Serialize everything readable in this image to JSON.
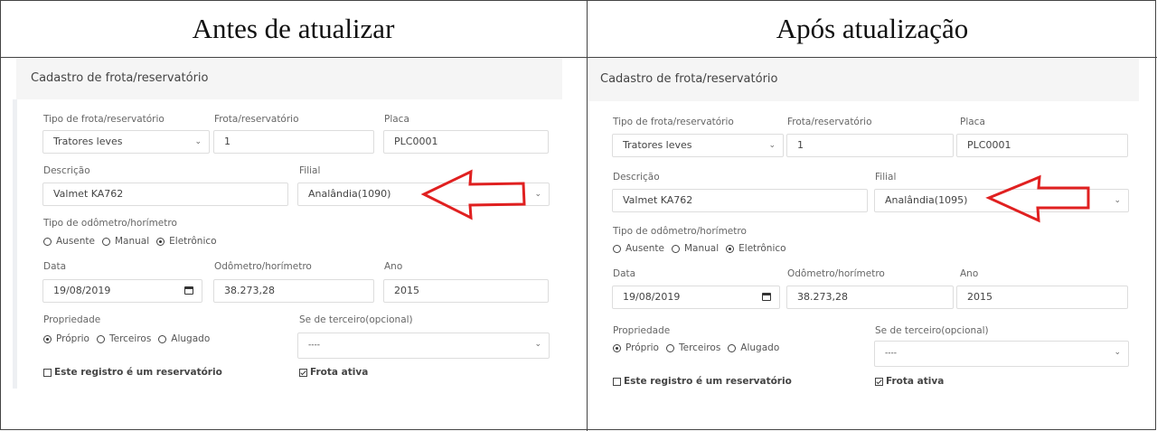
{
  "headers": {
    "left": "Antes de atualizar",
    "right": "Após atualização"
  },
  "form": {
    "title": "Cadastro de frota/reservatório",
    "tipo_label": "Tipo de frota/reservatório",
    "tipo_value": "Tratores leves",
    "frota_label": "Frota/reservatório",
    "frota_value": "1",
    "placa_label": "Placa",
    "placa_value": "PLC0001",
    "descricao_label": "Descrição",
    "descricao_value": "Valmet KA762",
    "filial_label": "Filial",
    "odometro_tipo_label": "Tipo de odômetro/horímetro",
    "odometro_options": [
      "Ausente",
      "Manual",
      "Eletrônico"
    ],
    "odometro_selected": "Eletrônico",
    "data_label": "Data",
    "data_value": "19/08/2019",
    "odometro_label": "Odômetro/horímetro",
    "odometro_value": "38.273,28",
    "ano_label": "Ano",
    "ano_value": "2015",
    "propriedade_label": "Propriedade",
    "propriedade_options": [
      "Próprio",
      "Terceiros",
      "Alugado"
    ],
    "propriedade_selected": "Próprio",
    "terceiro_label": "Se de terceiro(opcional)",
    "terceiro_value": "----",
    "reservatorio_label": "Este registro é um reservatório",
    "reservatorio_checked": false,
    "frota_ativa_label": "Frota ativa",
    "frota_ativa_checked": true
  },
  "before": {
    "filial_value": "Analândia(1090)"
  },
  "after": {
    "filial_value": "Analândia(1095)"
  },
  "arrow_color": "#e02020"
}
